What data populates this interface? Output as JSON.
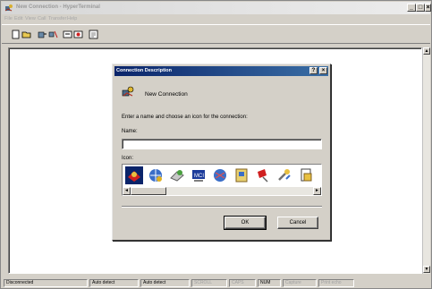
{
  "window": {
    "title": "New Connection - HyperTerminal",
    "buttons": {
      "minimize": "_",
      "maximize": "□",
      "close": "×"
    }
  },
  "menu": [
    "File",
    "Edit",
    "View",
    "Call",
    "Transfer",
    "Help"
  ],
  "toolbar": {
    "buttons": [
      "new-icon",
      "open-icon",
      "connect-icon",
      "disconnect-icon",
      "send-icon",
      "properties-icon"
    ]
  },
  "scrollbar": {
    "up": "▲",
    "down": "▼",
    "left": "◄",
    "right": "►"
  },
  "status": {
    "connection": "Disconnected",
    "detect1": "Auto detect",
    "detect2": "Auto detect",
    "scroll": "SCROLL",
    "caps": "CAPS",
    "num": "NUM",
    "capture": "Capture",
    "print": "Print echo"
  },
  "dialog": {
    "title": "Connection Description",
    "help": "?",
    "close": "×",
    "connection_name": "New Connection",
    "prompt": "Enter a name and choose an icon for the connection:",
    "name_label": "Name:",
    "name_value": "",
    "icon_label": "Icon:",
    "icons": [
      "phone-icon",
      "globe-icon",
      "modem-icon",
      "mci-icon",
      "network-icon",
      "folder-icon",
      "satellite-icon",
      "wrench-icon",
      "document-icon"
    ],
    "ok": "OK",
    "cancel": "Cancel"
  }
}
